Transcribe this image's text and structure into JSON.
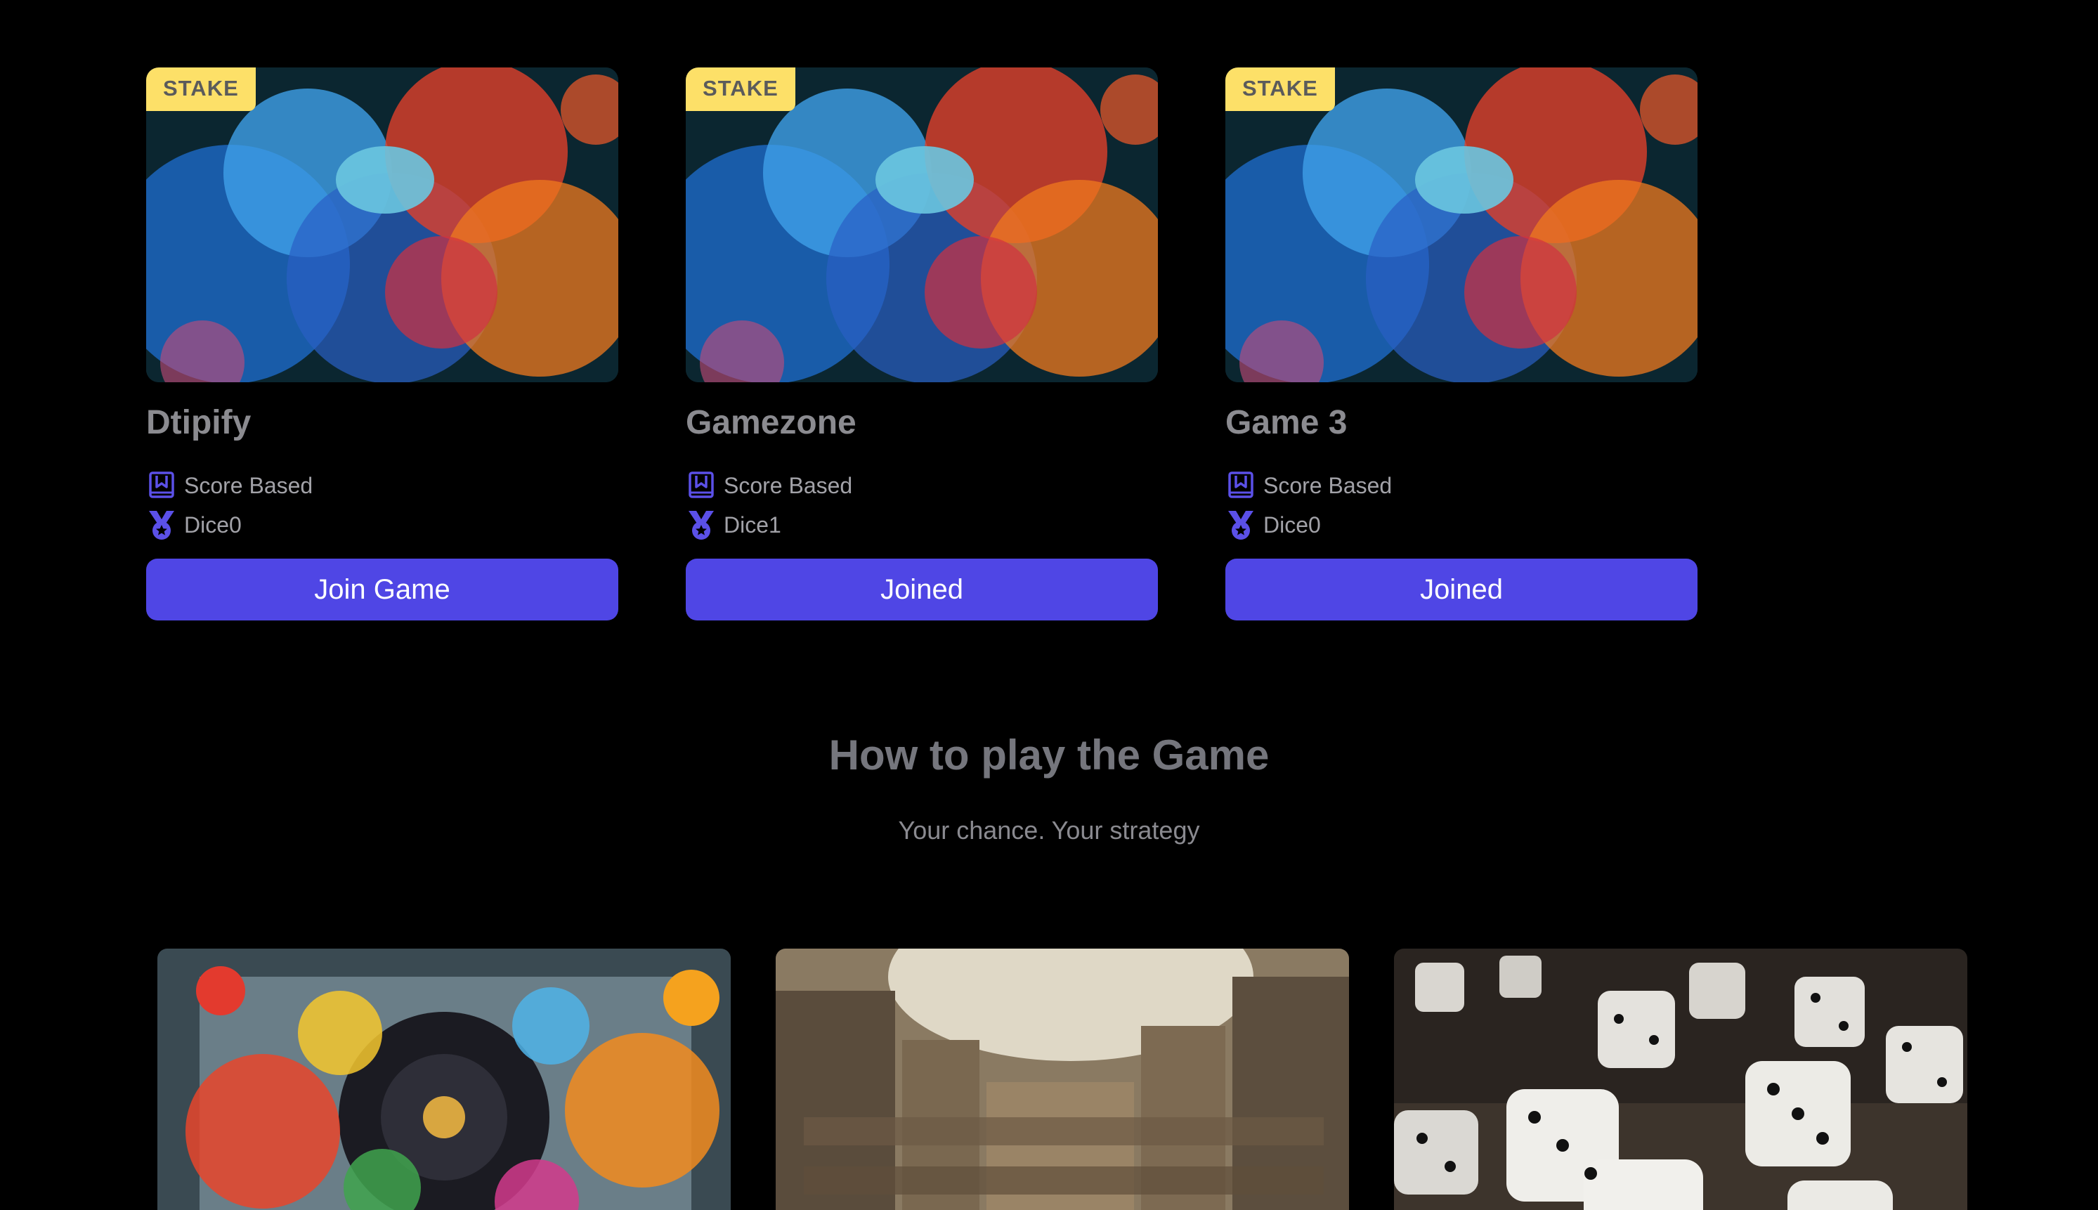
{
  "games": [
    {
      "badge": "STAKE",
      "title": "Dtipify",
      "mode": "Score Based",
      "dice": "Dice0",
      "button": "Join Game"
    },
    {
      "badge": "STAKE",
      "title": "Gamezone",
      "mode": "Score Based",
      "dice": "Dice1",
      "button": "Joined"
    },
    {
      "badge": "STAKE",
      "title": "Game 3",
      "mode": "Score Based",
      "dice": "Dice0",
      "button": "Joined"
    }
  ],
  "howto": {
    "title": "How to play the Game",
    "subtitle": "Your chance. Your strategy"
  },
  "icons": {
    "mode": "bookmark-board-icon",
    "dice": "medal-icon"
  },
  "colors": {
    "accent": "#4f46e5",
    "badge": "#fde068",
    "background": "#000000"
  }
}
